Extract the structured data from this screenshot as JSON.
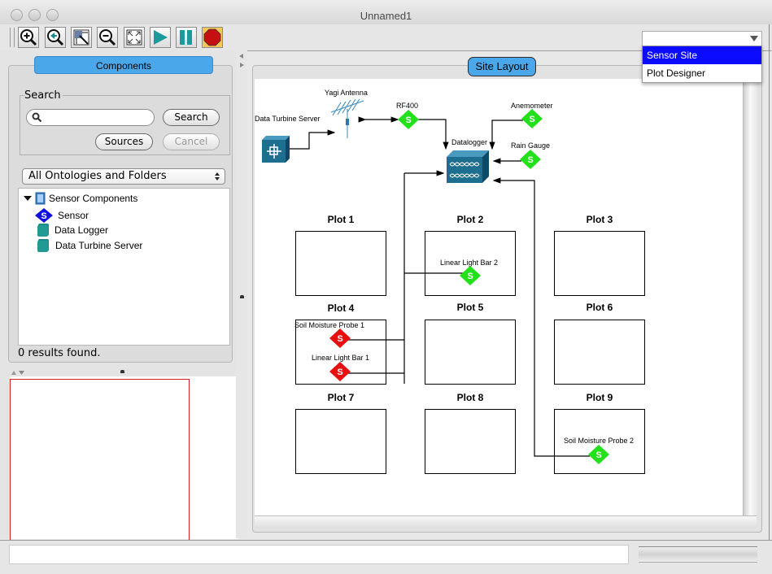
{
  "window": {
    "title": "Unnamed1"
  },
  "toolbar": {
    "buttons": [
      {
        "name": "zoom-in",
        "icon": "zoom-in-icon"
      },
      {
        "name": "zoom-previous",
        "icon": "zoom-back-icon"
      },
      {
        "name": "zoom-region",
        "icon": "zoom-region-icon"
      },
      {
        "name": "zoom-out",
        "icon": "zoom-out-icon"
      },
      {
        "name": "fit-to-window",
        "icon": "fit-window-icon"
      },
      {
        "name": "play",
        "icon": "play-icon"
      },
      {
        "name": "pause",
        "icon": "pause-icon"
      },
      {
        "name": "stop",
        "icon": "stop-icon",
        "active": true
      }
    ]
  },
  "view_selector": {
    "value": "",
    "options": [
      {
        "label": "Sensor Site",
        "selected": true
      },
      {
        "label": "Plot Designer",
        "selected": false
      }
    ]
  },
  "components": {
    "tab_label": "Components",
    "search": {
      "group_label": "Search",
      "input_value": "",
      "search_button": "Search",
      "sources_button": "Sources",
      "cancel_button": "Cancel"
    },
    "ontology_select": "All Ontologies and Folders",
    "tree": {
      "root": "Sensor Components",
      "children": [
        "Sensor",
        "Data Logger",
        "Data Turbine Server"
      ]
    },
    "results_text": "0 results found."
  },
  "site_layout": {
    "tab_label": "Site Layout",
    "devices": {
      "data_turbine_server": "Data Turbine Server",
      "yagi_antenna": "Yagi Antenna",
      "rf400": "RF400",
      "anemometer": "Anemometer",
      "rain_gauge": "Rain Gauge",
      "datalogger": "Datalogger"
    },
    "plots": [
      "Plot 1",
      "Plot 2",
      "Plot 3",
      "Plot 4",
      "Plot 5",
      "Plot 6",
      "Plot 7",
      "Plot 8",
      "Plot 9"
    ],
    "sensors": [
      {
        "label": "Linear Light Bar 2",
        "plot": "Plot 2",
        "status": "green"
      },
      {
        "label": "Soil Moisture Probe 1",
        "plot": "Plot 4",
        "status": "red"
      },
      {
        "label": "Linear Light Bar 1",
        "plot": "Plot 4",
        "status": "red"
      },
      {
        "label": "Soil Moisture Probe 2",
        "plot": "Plot 9",
        "status": "green"
      }
    ],
    "colors": {
      "sensor_green": "#22e01a",
      "sensor_red": "#e8100e",
      "device_teal": "#1e6e90",
      "sensor_blue": "#1010e0"
    }
  },
  "statusbar": {
    "text": ""
  }
}
